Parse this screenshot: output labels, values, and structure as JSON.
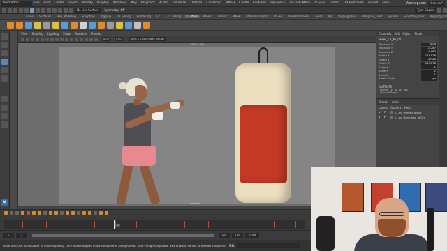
{
  "menubar": {
    "mode": "Animation",
    "items": [
      "File",
      "Edit",
      "Create",
      "Select",
      "Modify",
      "Display",
      "Windows",
      "Key",
      "Playback",
      "Audio",
      "Visualize",
      "Deform",
      "Constrain",
      "MASH",
      "Cache",
      "Lookdev",
      "Squareup",
      "Squash Mesh",
      "mGear",
      "Fabric",
      "TRIAnimTools",
      "Arnold",
      "Help"
    ],
    "workspace_label": "Workspace:",
    "workspace_value": "General*"
  },
  "statusline": {
    "no_live_surface": "No Live Surface",
    "symmetry": "Symmetry: Off",
    "user": "Tyler Gagen"
  },
  "shelf_tabs": [
    "Curves",
    "Surfaces",
    "Poly Modeling",
    "Sculpting",
    "Rigging",
    "UV Editing",
    "Rendering",
    "FX",
    "FX Caching",
    "Custom",
    "Arnold",
    "Bifrost",
    "MASH",
    "Motion Graphics",
    "XGen",
    "Animation Tools",
    "Anim",
    "Rig",
    "Rigging_User",
    "Polygons_User",
    "Squash",
    "Sculpting_User",
    "Rigging_User",
    "TURTLE"
  ],
  "shelf_active": "Custom",
  "shelf_colors": [
    "#e08a2e",
    "#e08a2e",
    "#5b9ad5",
    "#d8c04a",
    "#9a9a9a",
    "#d8c04a",
    "#5b9ad5",
    "#e08a2e",
    "#d0d0d0",
    "#5b9ad5",
    "#e08a2e",
    "#9a9a9a",
    "#d8c04a",
    "#5b9ad5",
    "#c0c0c0",
    "#e08a2e"
  ],
  "viewport": {
    "menus": [
      "View",
      "Shading",
      "Lighting",
      "Show",
      "Renderer",
      "Panels"
    ],
    "colorspace": "ACES 1.0 SDR-video (sRGB)",
    "exposure": "0.00",
    "gamma": "1.00",
    "camera_label": "1902 x 768",
    "camera_name": "camera1"
  },
  "chanbox": {
    "tabs": [
      "Channels",
      "Edit",
      "Object",
      "Show"
    ],
    "object_name": "Poses_LR_Av_ctl",
    "channels": [
      {
        "label": "Translate X",
        "value": "-4.00"
      },
      {
        "label": "Translate Y",
        "value": "-5.287"
      },
      {
        "label": "Translate Z",
        "value": "9.682"
      },
      {
        "label": "Rotate X",
        "value": "-121.826"
      },
      {
        "label": "Rotate Y",
        "value": "-87.86"
      },
      {
        "label": "Rotate Z",
        "value": "133.276"
      },
      {
        "label": "Scale X",
        "value": "1"
      },
      {
        "label": "Scale Y",
        "value": "1"
      },
      {
        "label": "Scale Z",
        "value": "1"
      },
      {
        "label": "Rotate Order",
        "value": "xyz"
      }
    ],
    "outputs_label": "OUTPUTS",
    "outputs": [
      "PickUp_LR_Av_ctl_Tag",
      "PickablePose1"
    ]
  },
  "layers": {
    "tabs": [
      "Display",
      "Anim"
    ],
    "menu": [
      "Layers",
      "Options",
      "Help"
    ],
    "rows": [
      {
        "v": "V",
        "p": "P",
        "name": "/...rig_woman_allGrs"
      },
      {
        "v": "V",
        "p": "P",
        "name": "/...rig_Heavybag_allGrs"
      }
    ]
  },
  "timeslider": {
    "current_frame": "27",
    "key_positions_pct": [
      6,
      14,
      22,
      30,
      37,
      44,
      52,
      60,
      68,
      75,
      83,
      90,
      97
    ],
    "playhead_pct": 36.5
  },
  "rangebar": {
    "start": "1",
    "range_start": "1",
    "range_end": "120",
    "end": "120",
    "fps": "24 fps"
  },
  "helpline": {
    "help": "Move Tool: Use manipulator to move object(s). Ctrl+middle-drag to move components along normal. Shift+drag manipulator axis or plane handle to extrude components or clone objects. Ctrl+Shift",
    "mel": "MEL"
  },
  "webcam": {
    "poster_colors": [
      "#b4582e",
      "#c33f2e",
      "#2f6db0",
      "#3b4b7d"
    ]
  }
}
